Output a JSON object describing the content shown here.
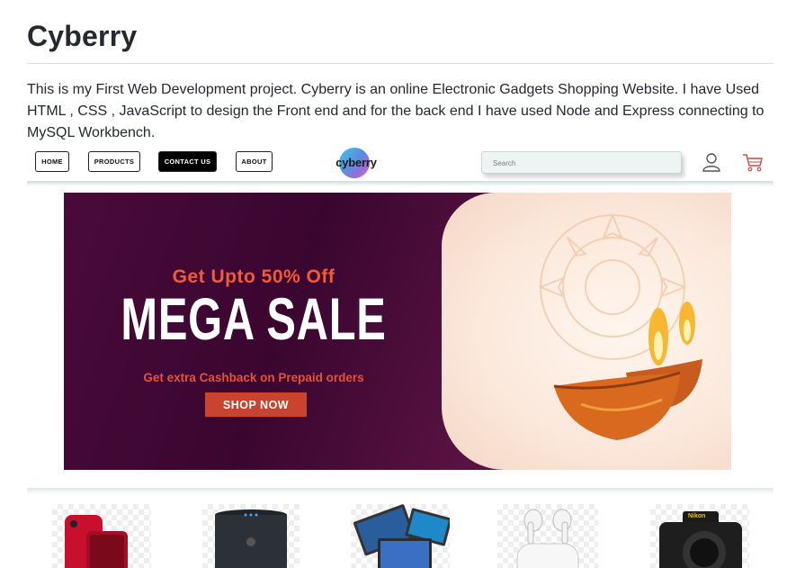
{
  "readme": {
    "title": "Cyberry",
    "description": "This is my First Web Development project. Cyberry is an online Electronic Gadgets Shopping Website. I have Used HTML , CSS , JavaScript to design the Front end and for the back end I have used Node and Express connecting to MySQL Workbench."
  },
  "site": {
    "nav": {
      "items": [
        {
          "label": "HOME"
        },
        {
          "label": "PRODUCTS"
        },
        {
          "label": "CONTACT US"
        },
        {
          "label": "ABOUT"
        }
      ],
      "logo_text": "cyberry",
      "search_placeholder": "Search",
      "user_icon": "user-icon",
      "cart_icon": "cart-icon"
    },
    "banner": {
      "offer": "Get Upto 50% Off",
      "headline": "MEGA SALE",
      "subtext": "Get extra Cashback on Prepaid orders",
      "cta": "SHOP NOW",
      "colors": {
        "background": "#4a0a3a",
        "accent": "#f15a3a",
        "cta": "#c9432e"
      }
    },
    "products": [
      {
        "icon": "iphone-icon"
      },
      {
        "icon": "smart-speaker-icon"
      },
      {
        "icon": "laptops-icon"
      },
      {
        "icon": "airpods-icon"
      },
      {
        "icon": "camera-icon"
      }
    ]
  }
}
